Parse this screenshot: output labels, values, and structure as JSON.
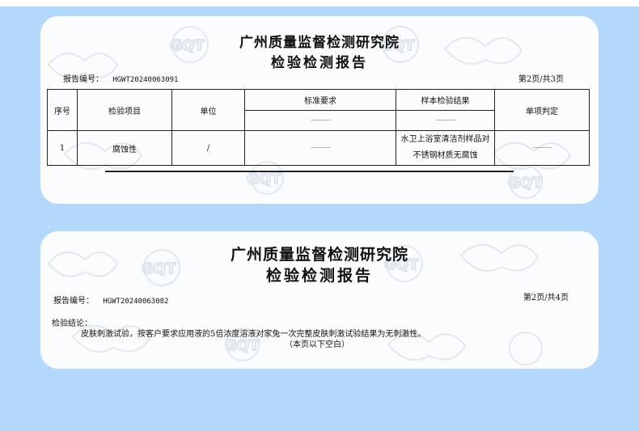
{
  "report1": {
    "org": "广州质量监督检测研究院",
    "title": "检验检测报告",
    "report_no_label": "报告编号：",
    "report_no": "HGWT20240063091",
    "page": "第2页/共3页",
    "headers": {
      "seq": "序号",
      "item": "检验项目",
      "unit": "单位",
      "standard": "标准要求",
      "result": "样本检验结果",
      "judgement": "单项判定"
    },
    "sub_dash": "———",
    "row": {
      "seq": "1",
      "item": "腐蚀性",
      "unit": "/",
      "standard": "———",
      "result_line1": "水卫上浴室清洁剂样品对",
      "result_line2": "不锈钢材质无腐蚀",
      "judgement": "———"
    }
  },
  "report2": {
    "org": "广州质量监督检测研究院",
    "title": "检验检测报告",
    "report_no_label": "报告编号：",
    "report_no": "HGWT20240063082",
    "page": "第2页/共4页",
    "conclusion_label": "检验结论：",
    "conclusion_text": "皮肤刺激试验，按客户要求应用液的5倍浓度溶液对家兔一次完整皮肤刺激试验结果为无刺激性。",
    "blank_note": "（本页以下空白）"
  },
  "watermark_text": "GQT",
  "colors": {
    "background": "#b3d8fb",
    "card": "#fbfcfd",
    "watermark": "#dfe6ee"
  }
}
